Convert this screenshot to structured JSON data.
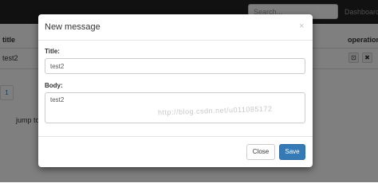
{
  "navbar": {
    "search_placeholder": "Search...",
    "dashboard_link": "Dashboard"
  },
  "table": {
    "columns": [
      "title",
      "operation"
    ],
    "rows": [
      {
        "title": "test2",
        "actions": [
          {
            "icon": "edit-icon",
            "glyph": "⊡"
          },
          {
            "icon": "delete-icon",
            "glyph": "✖"
          }
        ]
      }
    ]
  },
  "pagination": {
    "current_page": "1",
    "jump_label": "jump to"
  },
  "modal": {
    "title": "New message",
    "close_glyph": "×",
    "title_label": "Title:",
    "title_value": "test2",
    "body_label": "Body:",
    "body_value": "test2",
    "close_button": "Close",
    "save_button": "Save"
  },
  "watermark": "http://blog.csdn.net/u011085172",
  "colors": {
    "navbar": "#222222",
    "primary": "#337ab7",
    "backdrop": "rgba(0,0,0,0.5)"
  }
}
